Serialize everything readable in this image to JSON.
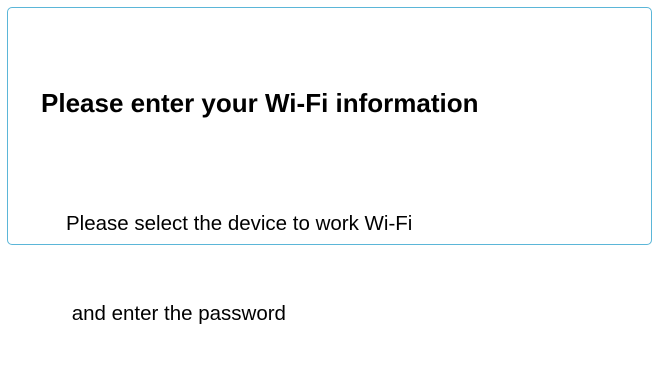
{
  "dialog": {
    "title": "Please enter your Wi-Fi information",
    "description_line1": "Please select the device to work Wi-Fi",
    "description_line2": " and enter the password"
  },
  "colors": {
    "border": "#5bb6d8",
    "text": "#000000",
    "background": "#ffffff"
  }
}
